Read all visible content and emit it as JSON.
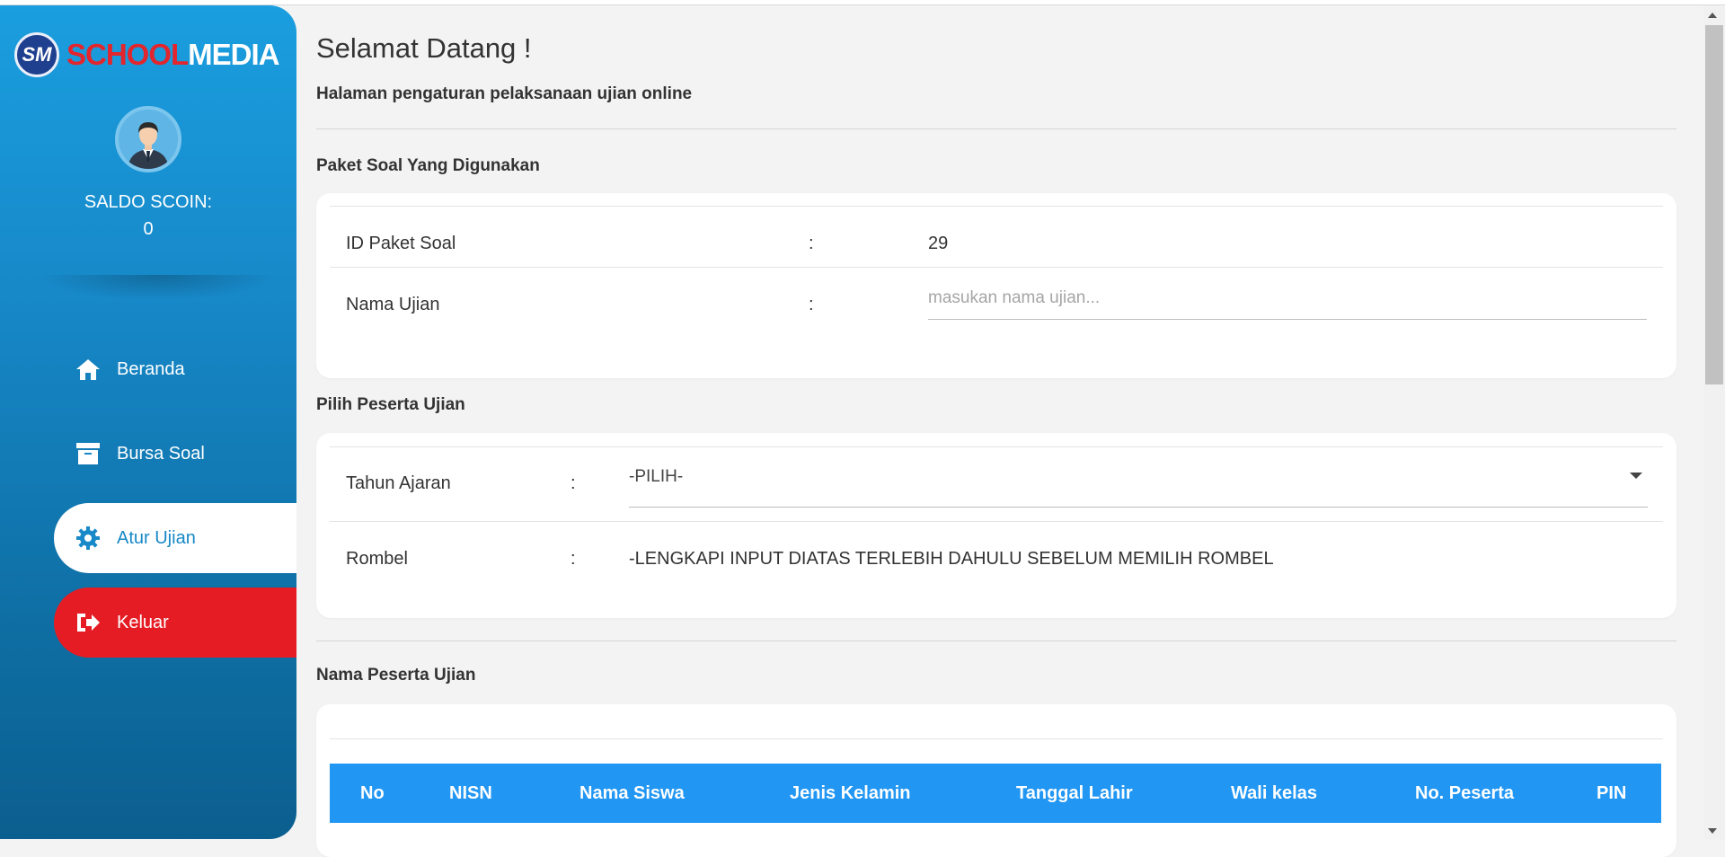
{
  "brand": {
    "badge": "SM",
    "name_red": "SCHOOL",
    "name_white": "MEDIA"
  },
  "user": {
    "saldo_label": "SALDO SCOIN:",
    "saldo_value": "0"
  },
  "sidebar": {
    "items": [
      {
        "label": "Beranda",
        "icon": "home-icon"
      },
      {
        "label": "Bursa Soal",
        "icon": "archive-icon"
      },
      {
        "label": "Atur Ujian",
        "icon": "gear-icon",
        "active": true
      },
      {
        "label": "Keluar",
        "icon": "sign-out-icon"
      }
    ]
  },
  "header": {
    "title": "Selamat Datang !",
    "subtitle": "Halaman pengaturan pelaksanaan ujian online"
  },
  "paket": {
    "section_title": "Paket Soal Yang Digunakan",
    "id_label": "ID Paket Soal",
    "id_value": "29",
    "nama_label": "Nama Ujian",
    "nama_placeholder": "masukan nama ujian...",
    "colon": ":"
  },
  "peserta": {
    "section_title": "Pilih Peserta Ujian",
    "tahun_label": "Tahun Ajaran",
    "tahun_selected": "-PILIH-",
    "rombel_label": "Rombel",
    "rombel_value": "-LENGKAPI INPUT DIATAS TERLEBIH DAHULU SEBELUM MEMILIH ROMBEL",
    "colon": ":"
  },
  "nama_peserta": {
    "section_title": "Nama Peserta Ujian",
    "columns": [
      "No",
      "NISN",
      "Nama Siswa",
      "Jenis Kelamin",
      "Tanggal Lahir",
      "Wali kelas",
      "No. Peserta",
      "PIN"
    ]
  },
  "colors": {
    "primary": "#2196f3",
    "logout": "#e51c23",
    "sidebar_top": "#1a9edf",
    "sidebar_bottom": "#0b5f8f"
  }
}
